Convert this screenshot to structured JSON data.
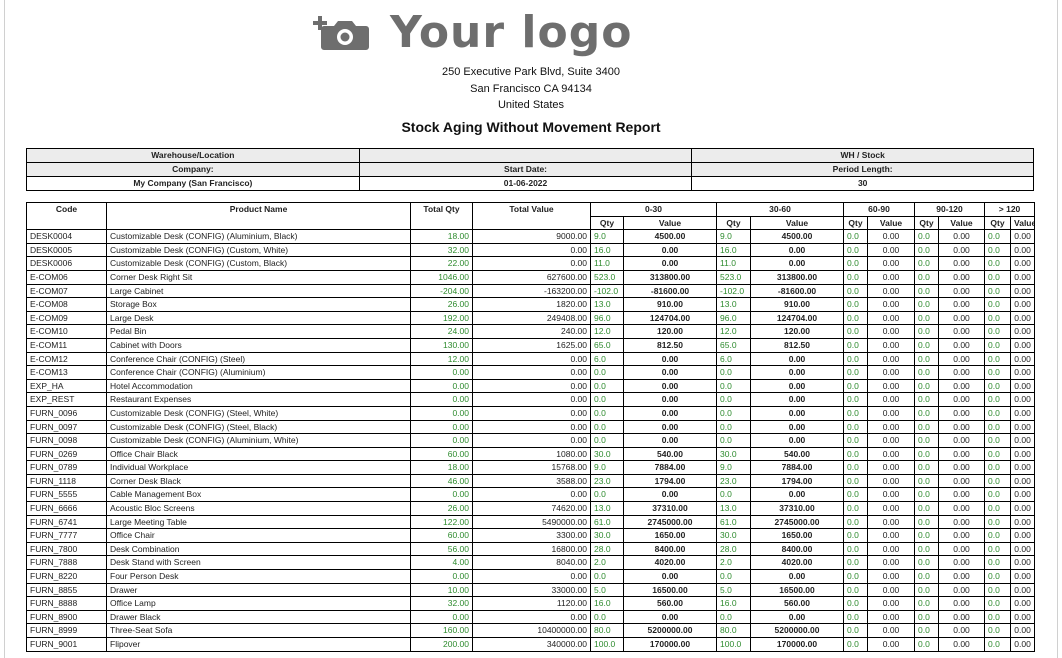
{
  "logo": {
    "text": "Your logo",
    "icon": "camera-plus-icon"
  },
  "address": [
    "250 Executive Park Blvd, Suite 3400",
    "San Francisco CA 94134",
    "United States"
  ],
  "report_title": "Stock Aging Without Movement Report",
  "info": {
    "warehouse_label": "Warehouse/Location",
    "warehouse_value": "",
    "wh_stock_label": "WH / Stock",
    "company_label": "Company:",
    "start_date_label": "Start Date:",
    "period_length_label": "Period Length:",
    "company_value": "My Company (San Francisco)",
    "start_date_value": "01-06-2022",
    "period_length_value": "30"
  },
  "columns": {
    "code": "Code",
    "product": "Product Name",
    "total_qty": "Total Qty",
    "total_value": "Total Value",
    "periods": [
      "0-30",
      "30-60",
      "60-90",
      "90-120",
      "> 120"
    ],
    "qty": "Qty",
    "value": "Value"
  },
  "rows": [
    {
      "code": "DESK0004",
      "name": "Customizable Desk (CONFIG) (Aluminium, Black)",
      "tq": "18.00",
      "tv": "9000.00",
      "p": [
        [
          "9.0",
          "4500.00"
        ],
        [
          "9.0",
          "4500.00"
        ],
        [
          "0.0",
          "0.00"
        ],
        [
          "0.0",
          "0.00"
        ],
        [
          "0.0",
          "0.00"
        ]
      ]
    },
    {
      "code": "DESK0005",
      "name": "Customizable Desk (CONFIG) (Custom, White)",
      "tq": "32.00",
      "tv": "0.00",
      "p": [
        [
          "16.0",
          "0.00"
        ],
        [
          "16.0",
          "0.00"
        ],
        [
          "0.0",
          "0.00"
        ],
        [
          "0.0",
          "0.00"
        ],
        [
          "0.0",
          "0.00"
        ]
      ]
    },
    {
      "code": "DESK0006",
      "name": "Customizable Desk (CONFIG) (Custom, Black)",
      "tq": "22.00",
      "tv": "0.00",
      "p": [
        [
          "11.0",
          "0.00"
        ],
        [
          "11.0",
          "0.00"
        ],
        [
          "0.0",
          "0.00"
        ],
        [
          "0.0",
          "0.00"
        ],
        [
          "0.0",
          "0.00"
        ]
      ]
    },
    {
      "code": "E-COM06",
      "name": "Corner Desk Right Sit",
      "tq": "1046.00",
      "tv": "627600.00",
      "p": [
        [
          "523.0",
          "313800.00"
        ],
        [
          "523.0",
          "313800.00"
        ],
        [
          "0.0",
          "0.00"
        ],
        [
          "0.0",
          "0.00"
        ],
        [
          "0.0",
          "0.00"
        ]
      ]
    },
    {
      "code": "E-COM07",
      "name": "Large Cabinet",
      "tq": "-204.00",
      "tv": "-163200.00",
      "p": [
        [
          "-102.0",
          "-81600.00"
        ],
        [
          "-102.0",
          "-81600.00"
        ],
        [
          "0.0",
          "0.00"
        ],
        [
          "0.0",
          "0.00"
        ],
        [
          "0.0",
          "0.00"
        ]
      ]
    },
    {
      "code": "E-COM08",
      "name": "Storage Box",
      "tq": "26.00",
      "tv": "1820.00",
      "p": [
        [
          "13.0",
          "910.00"
        ],
        [
          "13.0",
          "910.00"
        ],
        [
          "0.0",
          "0.00"
        ],
        [
          "0.0",
          "0.00"
        ],
        [
          "0.0",
          "0.00"
        ]
      ]
    },
    {
      "code": "E-COM09",
      "name": "Large Desk",
      "tq": "192.00",
      "tv": "249408.00",
      "p": [
        [
          "96.0",
          "124704.00"
        ],
        [
          "96.0",
          "124704.00"
        ],
        [
          "0.0",
          "0.00"
        ],
        [
          "0.0",
          "0.00"
        ],
        [
          "0.0",
          "0.00"
        ]
      ]
    },
    {
      "code": "E-COM10",
      "name": "Pedal Bin",
      "tq": "24.00",
      "tv": "240.00",
      "p": [
        [
          "12.0",
          "120.00"
        ],
        [
          "12.0",
          "120.00"
        ],
        [
          "0.0",
          "0.00"
        ],
        [
          "0.0",
          "0.00"
        ],
        [
          "0.0",
          "0.00"
        ]
      ]
    },
    {
      "code": "E-COM11",
      "name": "Cabinet with Doors",
      "tq": "130.00",
      "tv": "1625.00",
      "p": [
        [
          "65.0",
          "812.50"
        ],
        [
          "65.0",
          "812.50"
        ],
        [
          "0.0",
          "0.00"
        ],
        [
          "0.0",
          "0.00"
        ],
        [
          "0.0",
          "0.00"
        ]
      ]
    },
    {
      "code": "E-COM12",
      "name": "Conference Chair (CONFIG) (Steel)",
      "tq": "12.00",
      "tv": "0.00",
      "p": [
        [
          "6.0",
          "0.00"
        ],
        [
          "6.0",
          "0.00"
        ],
        [
          "0.0",
          "0.00"
        ],
        [
          "0.0",
          "0.00"
        ],
        [
          "0.0",
          "0.00"
        ]
      ]
    },
    {
      "code": "E-COM13",
      "name": "Conference Chair (CONFIG) (Aluminium)",
      "tq": "0.00",
      "tv": "0.00",
      "p": [
        [
          "0.0",
          "0.00"
        ],
        [
          "0.0",
          "0.00"
        ],
        [
          "0.0",
          "0.00"
        ],
        [
          "0.0",
          "0.00"
        ],
        [
          "0.0",
          "0.00"
        ]
      ]
    },
    {
      "code": "EXP_HA",
      "name": "Hotel Accommodation",
      "tq": "0.00",
      "tv": "0.00",
      "p": [
        [
          "0.0",
          "0.00"
        ],
        [
          "0.0",
          "0.00"
        ],
        [
          "0.0",
          "0.00"
        ],
        [
          "0.0",
          "0.00"
        ],
        [
          "0.0",
          "0.00"
        ]
      ]
    },
    {
      "code": "EXP_REST",
      "name": "Restaurant Expenses",
      "tq": "0.00",
      "tv": "0.00",
      "p": [
        [
          "0.0",
          "0.00"
        ],
        [
          "0.0",
          "0.00"
        ],
        [
          "0.0",
          "0.00"
        ],
        [
          "0.0",
          "0.00"
        ],
        [
          "0.0",
          "0.00"
        ]
      ]
    },
    {
      "code": "FURN_0096",
      "name": "Customizable Desk (CONFIG) (Steel, White)",
      "tq": "0.00",
      "tv": "0.00",
      "p": [
        [
          "0.0",
          "0.00"
        ],
        [
          "0.0",
          "0.00"
        ],
        [
          "0.0",
          "0.00"
        ],
        [
          "0.0",
          "0.00"
        ],
        [
          "0.0",
          "0.00"
        ]
      ]
    },
    {
      "code": "FURN_0097",
      "name": "Customizable Desk (CONFIG) (Steel, Black)",
      "tq": "0.00",
      "tv": "0.00",
      "p": [
        [
          "0.0",
          "0.00"
        ],
        [
          "0.0",
          "0.00"
        ],
        [
          "0.0",
          "0.00"
        ],
        [
          "0.0",
          "0.00"
        ],
        [
          "0.0",
          "0.00"
        ]
      ]
    },
    {
      "code": "FURN_0098",
      "name": "Customizable Desk (CONFIG) (Aluminium, White)",
      "tq": "0.00",
      "tv": "0.00",
      "p": [
        [
          "0.0",
          "0.00"
        ],
        [
          "0.0",
          "0.00"
        ],
        [
          "0.0",
          "0.00"
        ],
        [
          "0.0",
          "0.00"
        ],
        [
          "0.0",
          "0.00"
        ]
      ]
    },
    {
      "code": "FURN_0269",
      "name": "Office Chair Black",
      "tq": "60.00",
      "tv": "1080.00",
      "p": [
        [
          "30.0",
          "540.00"
        ],
        [
          "30.0",
          "540.00"
        ],
        [
          "0.0",
          "0.00"
        ],
        [
          "0.0",
          "0.00"
        ],
        [
          "0.0",
          "0.00"
        ]
      ]
    },
    {
      "code": "FURN_0789",
      "name": "Individual Workplace",
      "tq": "18.00",
      "tv": "15768.00",
      "p": [
        [
          "9.0",
          "7884.00"
        ],
        [
          "9.0",
          "7884.00"
        ],
        [
          "0.0",
          "0.00"
        ],
        [
          "0.0",
          "0.00"
        ],
        [
          "0.0",
          "0.00"
        ]
      ]
    },
    {
      "code": "FURN_1118",
      "name": "Corner Desk Black",
      "tq": "46.00",
      "tv": "3588.00",
      "p": [
        [
          "23.0",
          "1794.00"
        ],
        [
          "23.0",
          "1794.00"
        ],
        [
          "0.0",
          "0.00"
        ],
        [
          "0.0",
          "0.00"
        ],
        [
          "0.0",
          "0.00"
        ]
      ]
    },
    {
      "code": "FURN_5555",
      "name": "Cable Management Box",
      "tq": "0.00",
      "tv": "0.00",
      "p": [
        [
          "0.0",
          "0.00"
        ],
        [
          "0.0",
          "0.00"
        ],
        [
          "0.0",
          "0.00"
        ],
        [
          "0.0",
          "0.00"
        ],
        [
          "0.0",
          "0.00"
        ]
      ]
    },
    {
      "code": "FURN_6666",
      "name": "Acoustic Bloc Screens",
      "tq": "26.00",
      "tv": "74620.00",
      "p": [
        [
          "13.0",
          "37310.00"
        ],
        [
          "13.0",
          "37310.00"
        ],
        [
          "0.0",
          "0.00"
        ],
        [
          "0.0",
          "0.00"
        ],
        [
          "0.0",
          "0.00"
        ]
      ]
    },
    {
      "code": "FURN_6741",
      "name": "Large Meeting Table",
      "tq": "122.00",
      "tv": "5490000.00",
      "p": [
        [
          "61.0",
          "2745000.00"
        ],
        [
          "61.0",
          "2745000.00"
        ],
        [
          "0.0",
          "0.00"
        ],
        [
          "0.0",
          "0.00"
        ],
        [
          "0.0",
          "0.00"
        ]
      ]
    },
    {
      "code": "FURN_7777",
      "name": "Office Chair",
      "tq": "60.00",
      "tv": "3300.00",
      "p": [
        [
          "30.0",
          "1650.00"
        ],
        [
          "30.0",
          "1650.00"
        ],
        [
          "0.0",
          "0.00"
        ],
        [
          "0.0",
          "0.00"
        ],
        [
          "0.0",
          "0.00"
        ]
      ]
    },
    {
      "code": "FURN_7800",
      "name": "Desk Combination",
      "tq": "56.00",
      "tv": "16800.00",
      "p": [
        [
          "28.0",
          "8400.00"
        ],
        [
          "28.0",
          "8400.00"
        ],
        [
          "0.0",
          "0.00"
        ],
        [
          "0.0",
          "0.00"
        ],
        [
          "0.0",
          "0.00"
        ]
      ]
    },
    {
      "code": "FURN_7888",
      "name": "Desk Stand with Screen",
      "tq": "4.00",
      "tv": "8040.00",
      "p": [
        [
          "2.0",
          "4020.00"
        ],
        [
          "2.0",
          "4020.00"
        ],
        [
          "0.0",
          "0.00"
        ],
        [
          "0.0",
          "0.00"
        ],
        [
          "0.0",
          "0.00"
        ]
      ]
    },
    {
      "code": "FURN_8220",
      "name": "Four Person Desk",
      "tq": "0.00",
      "tv": "0.00",
      "p": [
        [
          "0.0",
          "0.00"
        ],
        [
          "0.0",
          "0.00"
        ],
        [
          "0.0",
          "0.00"
        ],
        [
          "0.0",
          "0.00"
        ],
        [
          "0.0",
          "0.00"
        ]
      ]
    },
    {
      "code": "FURN_8855",
      "name": "Drawer",
      "tq": "10.00",
      "tv": "33000.00",
      "p": [
        [
          "5.0",
          "16500.00"
        ],
        [
          "5.0",
          "16500.00"
        ],
        [
          "0.0",
          "0.00"
        ],
        [
          "0.0",
          "0.00"
        ],
        [
          "0.0",
          "0.00"
        ]
      ]
    },
    {
      "code": "FURN_8888",
      "name": "Office Lamp",
      "tq": "32.00",
      "tv": "1120.00",
      "p": [
        [
          "16.0",
          "560.00"
        ],
        [
          "16.0",
          "560.00"
        ],
        [
          "0.0",
          "0.00"
        ],
        [
          "0.0",
          "0.00"
        ],
        [
          "0.0",
          "0.00"
        ]
      ]
    },
    {
      "code": "FURN_8900",
      "name": "Drawer Black",
      "tq": "0.00",
      "tv": "0.00",
      "p": [
        [
          "0.0",
          "0.00"
        ],
        [
          "0.0",
          "0.00"
        ],
        [
          "0.0",
          "0.00"
        ],
        [
          "0.0",
          "0.00"
        ],
        [
          "0.0",
          "0.00"
        ]
      ]
    },
    {
      "code": "FURN_8999",
      "name": "Three-Seat Sofa",
      "tq": "160.00",
      "tv": "10400000.00",
      "p": [
        [
          "80.0",
          "5200000.00"
        ],
        [
          "80.0",
          "5200000.00"
        ],
        [
          "0.0",
          "0.00"
        ],
        [
          "0.0",
          "0.00"
        ],
        [
          "0.0",
          "0.00"
        ]
      ]
    },
    {
      "code": "FURN_9001",
      "name": "Flipover",
      "tq": "200.00",
      "tv": "340000.00",
      "p": [
        [
          "100.0",
          "170000.00"
        ],
        [
          "100.0",
          "170000.00"
        ],
        [
          "0.0",
          "0.00"
        ],
        [
          "0.0",
          "0.00"
        ],
        [
          "0.0",
          "0.00"
        ]
      ]
    }
  ],
  "colors": {
    "qty_green": "#2e8b2e",
    "logo_gray": "#6e6e6e",
    "header_shade": "#ececec"
  }
}
